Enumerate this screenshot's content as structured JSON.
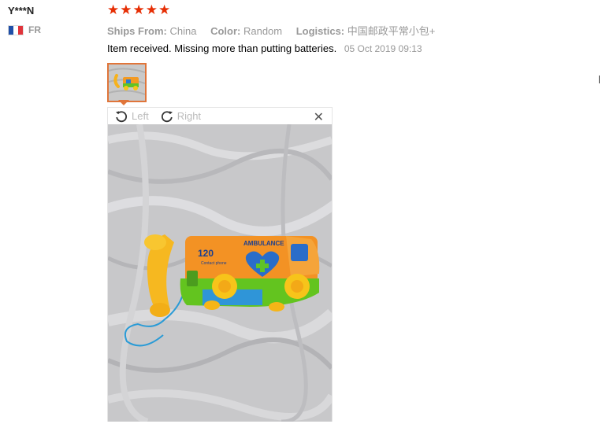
{
  "review": {
    "user": "Y***N",
    "country_code": "FR",
    "rating": 5,
    "stars": [
      "★",
      "★",
      "★",
      "★",
      "★"
    ],
    "ships_from_label": "Ships From:",
    "ships_from_value": "China",
    "color_label": "Color:",
    "color_value": "Random",
    "logistics_label": "Logistics:",
    "logistics_value": "中国邮政平常小包+",
    "text": "Item received. Missing more than putting batteries.",
    "date": "05 Oct 2019 09:13"
  },
  "viewer": {
    "rotate_left_label": "Left",
    "rotate_right_label": "Right",
    "close_glyph": "✕"
  },
  "colors": {
    "star": "#e62e04",
    "thumb_border": "#e0753a"
  },
  "icons": [
    "flag-fr-icon",
    "star-icon",
    "rotate-left-icon",
    "rotate-right-icon",
    "close-icon"
  ]
}
